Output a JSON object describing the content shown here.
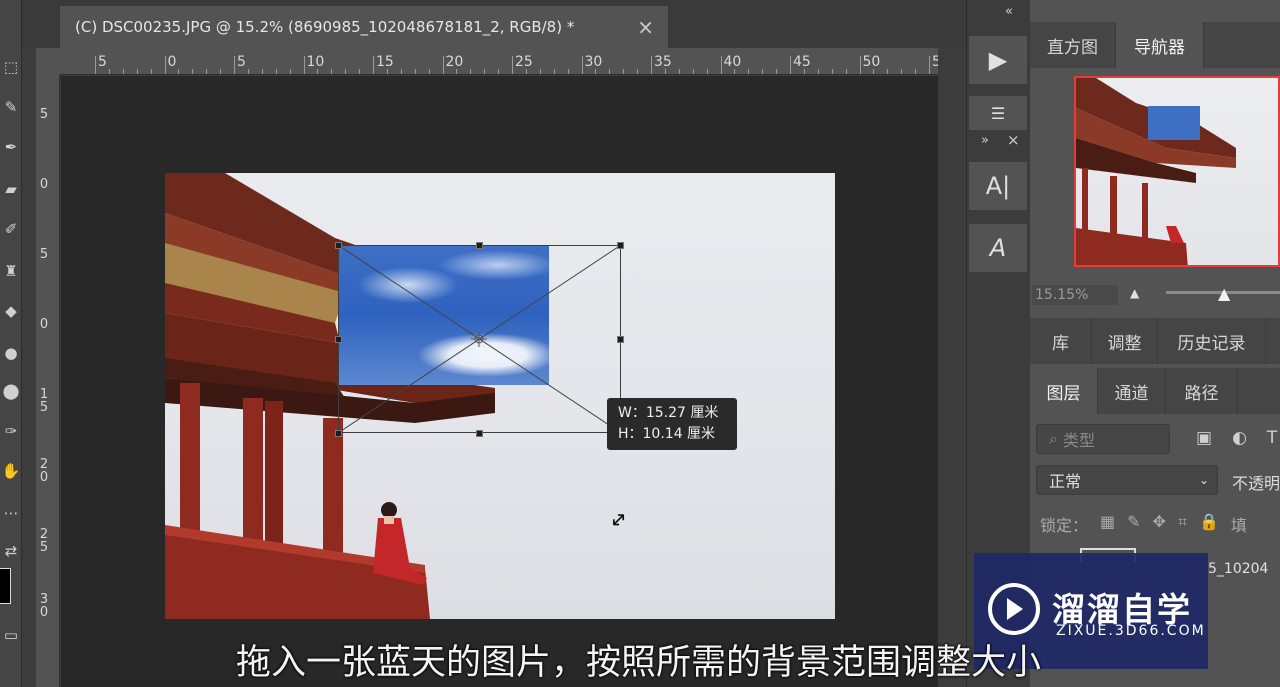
{
  "document": {
    "tab_title": "(C) DSC00235.JPG @ 15.2% (8690985_102048678181_2, RGB/8) *",
    "close_glyph": "×"
  },
  "rulers": {
    "horizontal": [
      "5",
      "0",
      "5",
      "10",
      "15",
      "20",
      "25",
      "30",
      "35",
      "40",
      "45",
      "50",
      "5"
    ],
    "vertical": [
      "5",
      "0",
      "5",
      "0",
      "1\n5",
      "2\n0",
      "2\n5",
      "3\n0"
    ]
  },
  "transform_info": {
    "width": "W：15.27 厘米",
    "height": "H：10.14 厘米"
  },
  "right_panel": {
    "top_tabs": [
      "直方图",
      "导航器"
    ],
    "active_top_tab": "导航器",
    "zoom_value": "15.15%",
    "mid_tabs": [
      "库",
      "调整",
      "历史记录"
    ],
    "layer_tabs": [
      "图层",
      "通道",
      "路径"
    ],
    "filter_placeholder": "类型",
    "blend_mode": "正常",
    "opacity_label": "不透明",
    "lock_label": "锁定：",
    "fill_partial": "填",
    "layer_name_partial": "5_10204"
  },
  "subtitle": "拖入一张蓝天的图片，按照所需的背景范围调整大小",
  "watermark": {
    "name": "溜溜自学",
    "url": "ZIXUE.3D66.COM"
  },
  "colors": {
    "panel_bg": "#535353",
    "canvas_bg": "#282828",
    "nav_highlight": "#e23c3c",
    "sky_blue": "#2f62bf"
  }
}
